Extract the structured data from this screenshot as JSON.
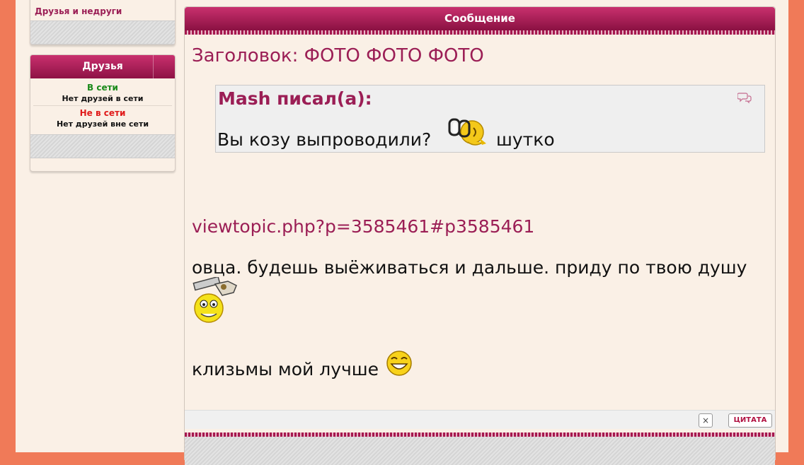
{
  "sidebar": {
    "link": "Друзья и недруги",
    "friends": {
      "title": "Друзья",
      "online_label": "В сети",
      "online_note": "Нет друзей в сети",
      "offline_label": "Не в сети",
      "offline_note": "Нет друзей вне сети"
    }
  },
  "message": {
    "header": "Сообщение",
    "subject": "Заголовок: ФОТО ФОТО ФОТО",
    "quote": {
      "author": "Mash писал(а):",
      "text_before": "Вы козу выпроводили?",
      "text_after": "шутко"
    },
    "link": "viewtopic.php?p=3585461#p3585461",
    "line1": "овца. будешь выёживаться и дальше. приду по твою душу",
    "line2": "клизьмы мой лучше",
    "quote_button": "ЦИТАТА",
    "close_button": "×"
  },
  "colors": {
    "accent": "#9b1e55",
    "header_top": "#c9306e",
    "header_bottom": "#8a1142",
    "background": "#faf0e6",
    "outer": "#f07a58"
  },
  "icons": [
    "quote-bubble-icon",
    "glasses-smiley-icon",
    "fix-smiley-icon",
    "laughing-smiley-icon",
    "close-icon"
  ]
}
